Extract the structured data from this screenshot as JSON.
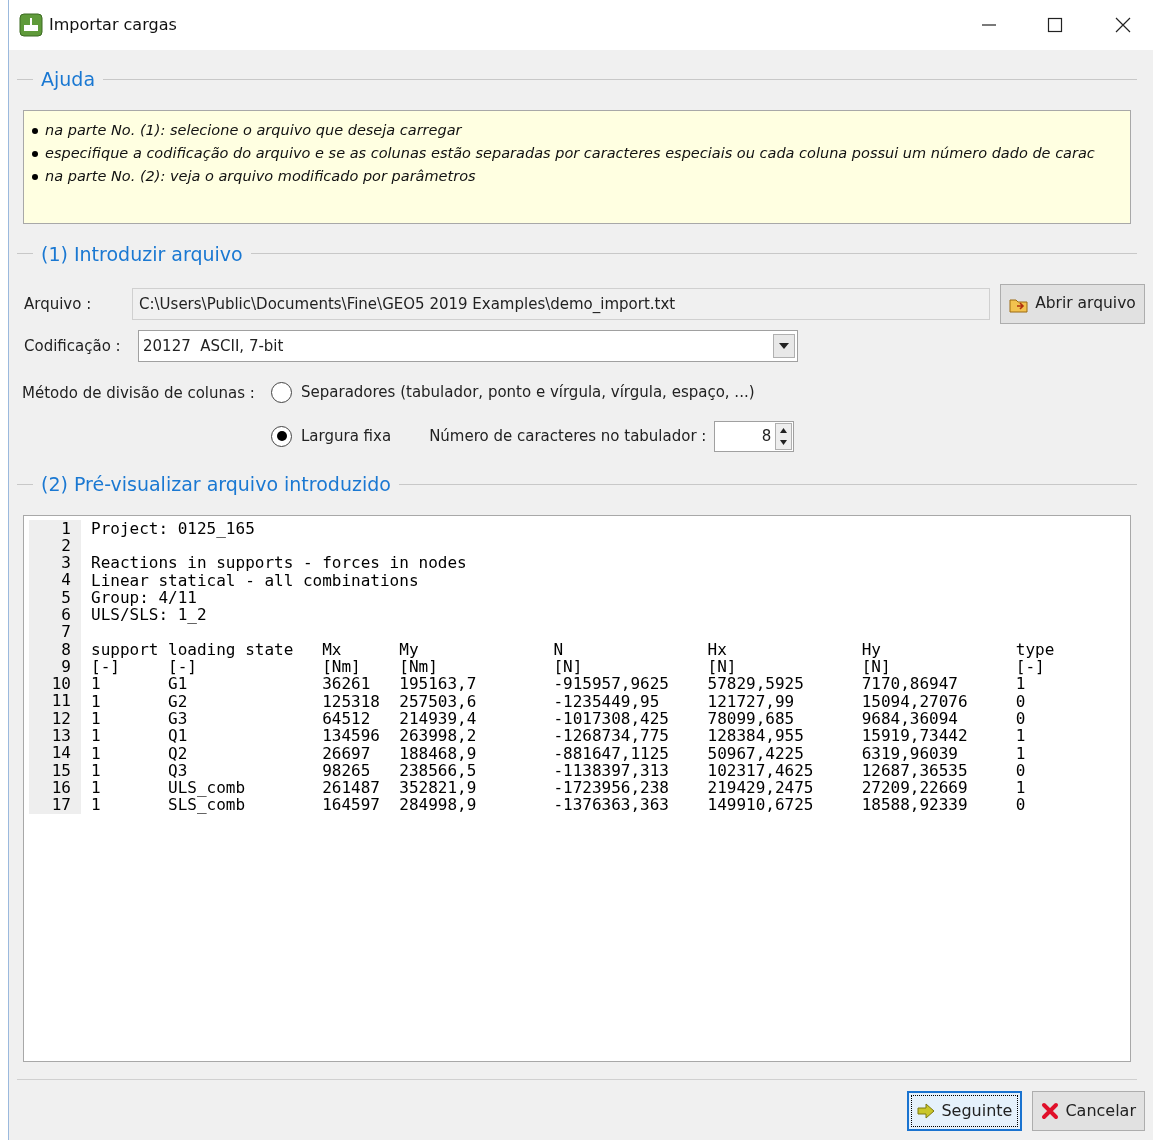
{
  "window": {
    "title": "Importar cargas"
  },
  "help": {
    "title": "Ajuda",
    "items": [
      "na parte No. (1): selecione o arquivo que deseja carregar",
      "especifique a codificação do arquivo e se as colunas estão separadas por caracteres especiais ou cada coluna possui um número dado de carac",
      "na parte No. (2): veja o arquivo modificado por parâmetros"
    ]
  },
  "input_section": {
    "title": "(1) Introduzir arquivo",
    "file": {
      "label": "Arquivo :",
      "value": "C:\\Users\\Public\\Documents\\Fine\\GEO5 2019 Examples\\demo_import.txt"
    },
    "open_button": "Abrir arquivo",
    "encoding": {
      "label": "Codificação :",
      "value": "20127  ASCII, 7-bit"
    },
    "method": {
      "label": "Método de divisão de colunas :",
      "options": [
        {
          "label": "Separadores (tabulador, ponto e vírgula, vírgula, espaço, ...)",
          "selected": false
        },
        {
          "label": "Largura fixa",
          "selected": true
        }
      ]
    },
    "tab_chars": {
      "label": "Número de caracteres no tabulador :",
      "value": "8"
    }
  },
  "preview_section": {
    "title": "(2) Pré-visualizar arquivo introduzido",
    "lines": [
      {
        "number": "1",
        "text": "Project: 0125_165"
      },
      {
        "number": "2"
      },
      {
        "number": "3",
        "text": "Reactions in supports - forces in nodes"
      },
      {
        "number": "4",
        "text": "Linear statical - all combinations"
      },
      {
        "number": "5",
        "text": "Group: 4/11"
      },
      {
        "number": "6",
        "text": "ULS/SLS: 1_2"
      },
      {
        "number": "7"
      },
      {
        "number": "8",
        "text": "support loading state   Mx      My              N               Hx              Hy              type"
      },
      {
        "number": "9",
        "text": "[-]     [-]             [Nm]    [Nm]            [N]             [N]             [N]             [-]"
      },
      {
        "number": "10",
        "text": "1       G1              36261   195163,7        -915957,9625    57829,5925      7170,86947      1"
      },
      {
        "number": "11",
        "text": "1       G2              125318  257503,6        -1235449,95     121727,99       15094,27076     0"
      },
      {
        "number": "12",
        "text": "1       G3              64512   214939,4        -1017308,425    78099,685       9684,36094      0"
      },
      {
        "number": "13",
        "text": "1       Q1              134596  263998,2        -1268734,775    128384,955      15919,73442     1"
      },
      {
        "number": "14",
        "text": "1       Q2              26697   188468,9        -881647,1125    50967,4225      6319,96039      1"
      },
      {
        "number": "15",
        "text": "1       Q3              98265   238566,5        -1138397,313    102317,4625     12687,36535     0"
      },
      {
        "number": "16",
        "text": "1       ULS_comb        261487  352821,9        -1723956,238    219429,2475     27209,22669     1"
      },
      {
        "number": "17",
        "text": "1       SLS_comb        164597  284998,9        -1376363,363    149910,6725     18588,92339     0"
      }
    ]
  },
  "buttons": [
    {
      "label": "Seguinte",
      "kind": "next",
      "focused": true
    },
    {
      "label": "Cancelar",
      "kind": "cancel",
      "focused": false
    }
  ]
}
